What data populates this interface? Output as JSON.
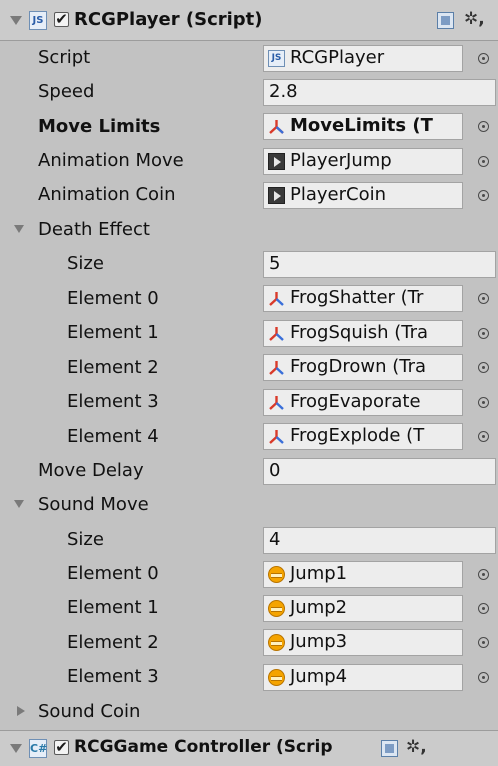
{
  "component": {
    "title": "RCGPlayer (Script)",
    "enabled_mark": "✔"
  },
  "fields": {
    "script": {
      "label": "Script",
      "value": "RCGPlayer"
    },
    "speed": {
      "label": "Speed",
      "value": "2.8"
    },
    "move_limits": {
      "label": "Move Limits",
      "value": "MoveLimits (T"
    },
    "animation_move": {
      "label": "Animation Move",
      "value": "PlayerJump"
    },
    "animation_coin": {
      "label": "Animation Coin",
      "value": "PlayerCoin"
    },
    "death_effect": {
      "label": "Death Effect",
      "size_label": "Size",
      "size": "5",
      "elements": [
        {
          "label": "Element 0",
          "value": "FrogShatter (Tr"
        },
        {
          "label": "Element 1",
          "value": "FrogSquish (Tra"
        },
        {
          "label": "Element 2",
          "value": "FrogDrown (Tra"
        },
        {
          "label": "Element 3",
          "value": "FrogEvaporate"
        },
        {
          "label": "Element 4",
          "value": "FrogExplode (T"
        }
      ]
    },
    "move_delay": {
      "label": "Move Delay",
      "value": "0"
    },
    "sound_move": {
      "label": "Sound Move",
      "size_label": "Size",
      "size": "4",
      "elements": [
        {
          "label": "Element 0",
          "value": "Jump1"
        },
        {
          "label": "Element 1",
          "value": "Jump2"
        },
        {
          "label": "Element 2",
          "value": "Jump3"
        },
        {
          "label": "Element 3",
          "value": "Jump4"
        }
      ]
    },
    "sound_coin": {
      "label": "Sound Coin"
    }
  },
  "next_component": {
    "title": "RCGGame Controller (Scrip"
  },
  "icons": {
    "js": "JS",
    "cs": "C#",
    "gear": "✲,",
    "transform": "transform-icon",
    "animation": "animation-clip-icon",
    "audio": "audio-clip-icon"
  },
  "colors": {
    "panel": "#c2c2c2",
    "field": "#ededed",
    "header": "#cbcbcb",
    "audio_icon": "#f5a400"
  }
}
